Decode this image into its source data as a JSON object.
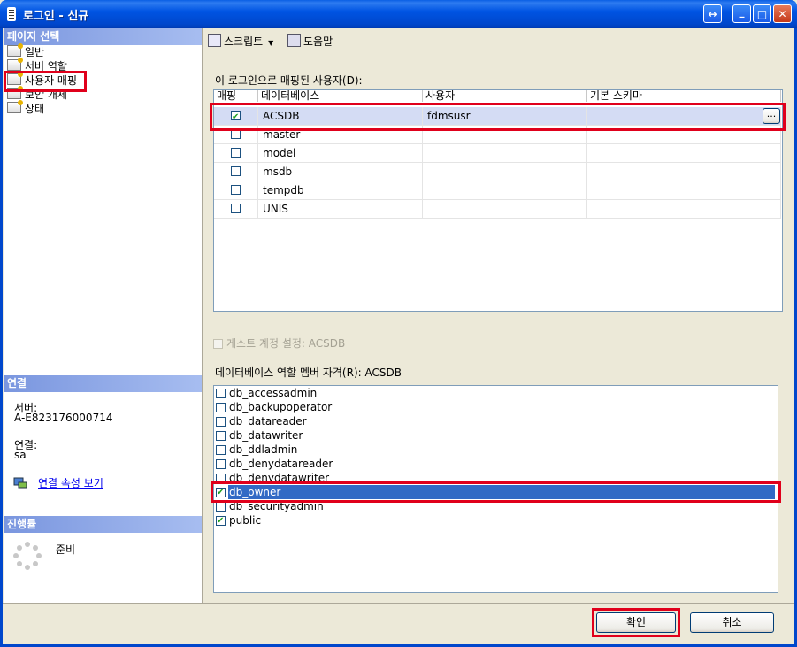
{
  "window": {
    "title": "로그인 - 신규",
    "controls": [
      "↔",
      "_",
      "□",
      "✕"
    ]
  },
  "left": {
    "page_select_header": "페이지 선택",
    "pages": [
      "일반",
      "서버 역할",
      "사용자 매핑",
      "보안 개체",
      "상태"
    ],
    "connection_header": "연결",
    "server_label": "서버:",
    "server_value": "A-E823176000714",
    "connection_label": "연결:",
    "connection_value": "sa",
    "view_props_link": "연결 속성 보기",
    "progress_header": "진행률",
    "progress_status": "준비"
  },
  "toolbar": {
    "script_label": "스크립트",
    "help_label": "도움말"
  },
  "mapping": {
    "label": "이 로그인으로 매핑된 사용자(D):",
    "columns": [
      "매핑",
      "데이터베이스",
      "사용자",
      "기본 스키마"
    ],
    "rows": [
      {
        "checked": true,
        "database": "ACSDB",
        "user": "fdmsusr",
        "schema": ""
      },
      {
        "checked": false,
        "database": "master",
        "user": "",
        "schema": ""
      },
      {
        "checked": false,
        "database": "model",
        "user": "",
        "schema": ""
      },
      {
        "checked": false,
        "database": "msdb",
        "user": "",
        "schema": ""
      },
      {
        "checked": false,
        "database": "tempdb",
        "user": "",
        "schema": ""
      },
      {
        "checked": false,
        "database": "UNIS",
        "user": "",
        "schema": ""
      }
    ],
    "browse_button": "..."
  },
  "guest": {
    "label": "게스트 계정 설정: ACSDB"
  },
  "roles": {
    "label": "데이터베이스 역할 멤버 자격(R): ACSDB",
    "items": [
      {
        "name": "db_accessadmin",
        "checked": false
      },
      {
        "name": "db_backupoperator",
        "checked": false
      },
      {
        "name": "db_datareader",
        "checked": false
      },
      {
        "name": "db_datawriter",
        "checked": false
      },
      {
        "name": "db_ddladmin",
        "checked": false
      },
      {
        "name": "db_denydatareader",
        "checked": false
      },
      {
        "name": "db_denydatawriter",
        "checked": false
      },
      {
        "name": "db_owner",
        "checked": true
      },
      {
        "name": "db_securityadmin",
        "checked": false
      },
      {
        "name": "public",
        "checked": true
      }
    ]
  },
  "footer": {
    "ok_label": "확인",
    "cancel_label": "취소"
  },
  "colors": {
    "highlight_red": "#e0001b",
    "selection_blue": "#316ac5",
    "titlebar_blue": "#0054e3"
  }
}
